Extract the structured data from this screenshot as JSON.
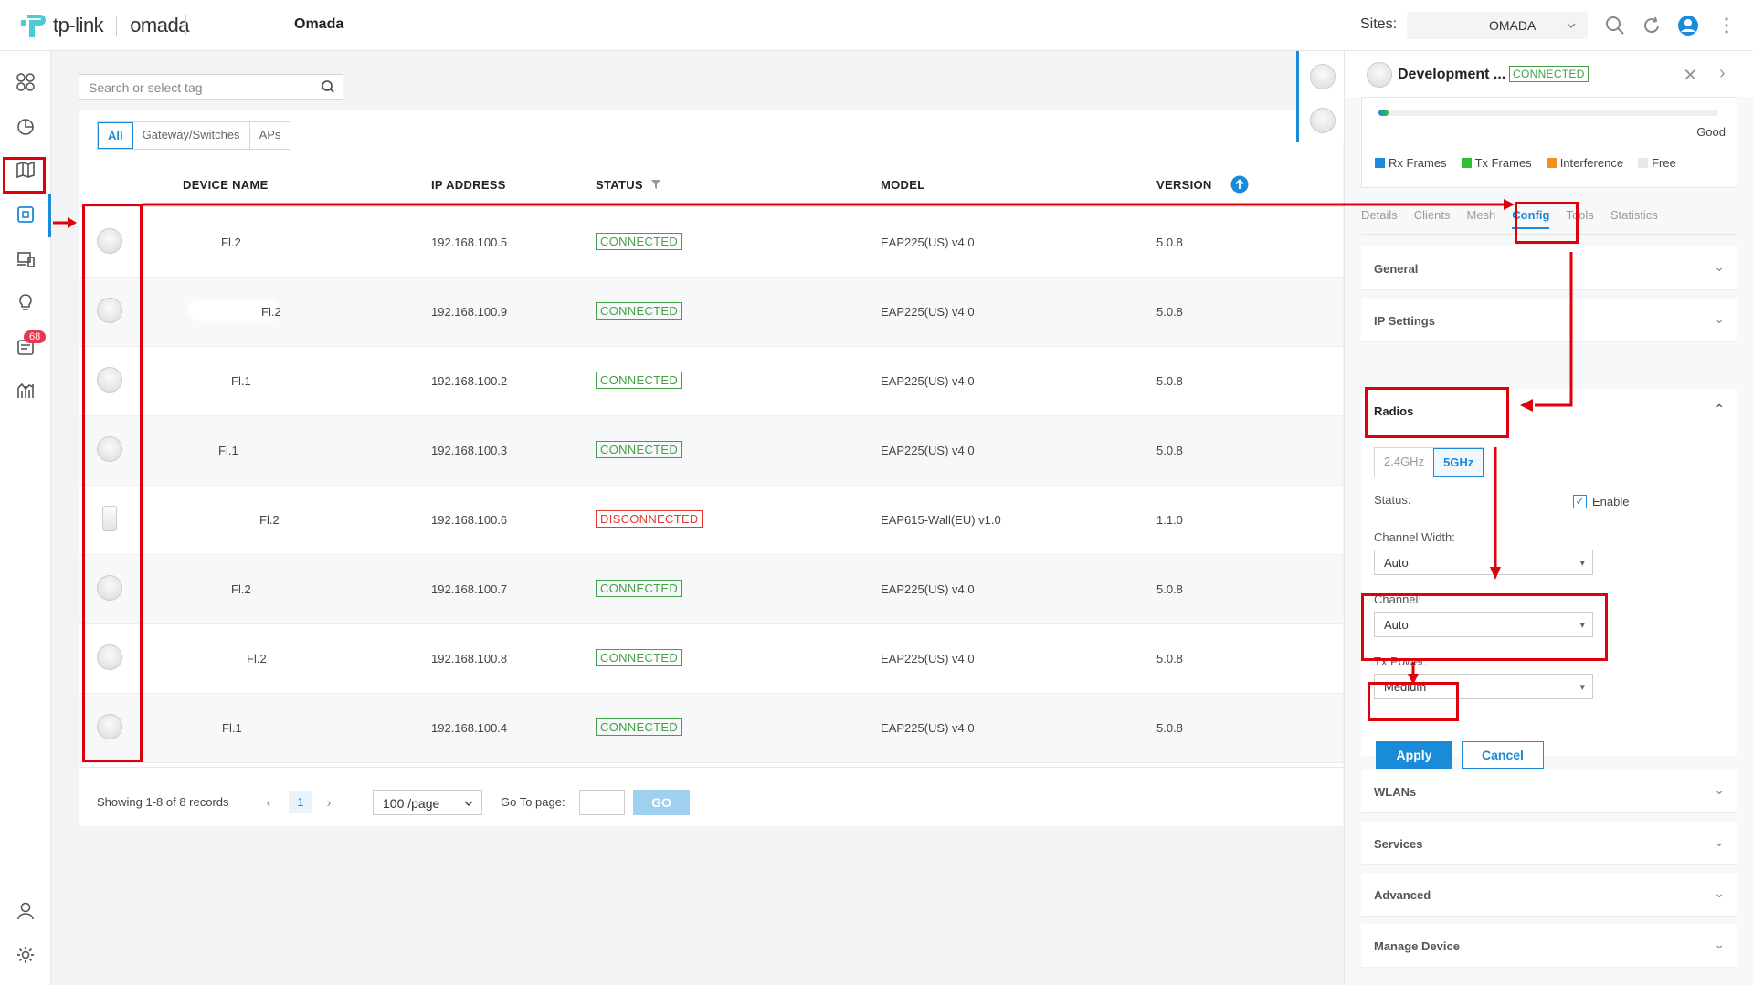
{
  "header": {
    "brand_name": "tp-link",
    "product_name": "omada",
    "controller_name": "Omada",
    "sites_label": "Sites:",
    "site_selected": "OMADA"
  },
  "nav": {
    "badge_count": "68",
    "items": [
      "dashboard-icon",
      "statistics-icon",
      "map-icon",
      "devices-icon",
      "clients-icon",
      "insight-icon",
      "logs-icon",
      "reports-icon",
      "account-icon",
      "settings-icon"
    ]
  },
  "main": {
    "search_placeholder": "Search or select tag",
    "filters": [
      "All",
      "Gateway/Switches",
      "APs"
    ],
    "columns": [
      "DEVICE NAME",
      "IP ADDRESS",
      "STATUS",
      "MODEL",
      "VERSION"
    ],
    "rows": [
      {
        "name": "Fl.2",
        "ip": "192.168.100.5",
        "status": "CONNECTED",
        "model": "EAP225(US) v4.0",
        "version": "5.0.8"
      },
      {
        "name": "Fl.2",
        "ip": "192.168.100.9",
        "status": "CONNECTED",
        "model": "EAP225(US) v4.0",
        "version": "5.0.8"
      },
      {
        "name": "Fl.1",
        "ip": "192.168.100.2",
        "status": "CONNECTED",
        "model": "EAP225(US) v4.0",
        "version": "5.0.8"
      },
      {
        "name": "Fl.1",
        "ip": "192.168.100.3",
        "status": "CONNECTED",
        "model": "EAP225(US) v4.0",
        "version": "5.0.8"
      },
      {
        "name": "Fl.2",
        "ip": "192.168.100.6",
        "status": "DISCONNECTED",
        "model": "EAP615-Wall(EU) v1.0",
        "version": "1.1.0"
      },
      {
        "name": "Fl.2",
        "ip": "192.168.100.7",
        "status": "CONNECTED",
        "model": "EAP225(US) v4.0",
        "version": "5.0.8"
      },
      {
        "name": "Fl.2",
        "ip": "192.168.100.8",
        "status": "CONNECTED",
        "model": "EAP225(US) v4.0",
        "version": "5.0.8"
      },
      {
        "name": "Fl.1",
        "ip": "192.168.100.4",
        "status": "CONNECTED",
        "model": "EAP225(US) v4.0",
        "version": "5.0.8"
      }
    ],
    "pager": {
      "showing": "Showing 1-8 of 8 records",
      "page": "1",
      "page_size": "100 /page",
      "goto_label": "Go To page:",
      "go_label": "GO"
    }
  },
  "drawer": {
    "title": "Development ...",
    "status": "CONNECTED",
    "utilization_label": "Good",
    "utilization_level": 0.03,
    "legend": [
      {
        "label": "Rx Frames",
        "color": "#1a8bd9"
      },
      {
        "label": "Tx Frames",
        "color": "#2fbf2f"
      },
      {
        "label": "Interference",
        "color": "#f5901e"
      },
      {
        "label": "Free",
        "color": "#e8e8e8"
      }
    ],
    "tabs": [
      "Details",
      "Clients",
      "Mesh",
      "Config",
      "Tools",
      "Statistics"
    ],
    "sections": {
      "general": "General",
      "ip_settings": "IP Settings",
      "radios": "Radios",
      "wlans": "WLANs",
      "services": "Services",
      "advanced": "Advanced",
      "manage_device": "Manage Device"
    },
    "radios": {
      "bands": [
        "2.4GHz",
        "5GHz"
      ],
      "status_label": "Status:",
      "enable_label": "Enable",
      "enable_mark": "✓",
      "channel_width_label": "Channel Width:",
      "channel_width_value": "Auto",
      "channel_label": "Channel:",
      "channel_value": "Auto",
      "tx_power_label": "Tx Power:",
      "tx_power_value": "Medium",
      "apply_label": "Apply",
      "cancel_label": "Cancel"
    }
  }
}
